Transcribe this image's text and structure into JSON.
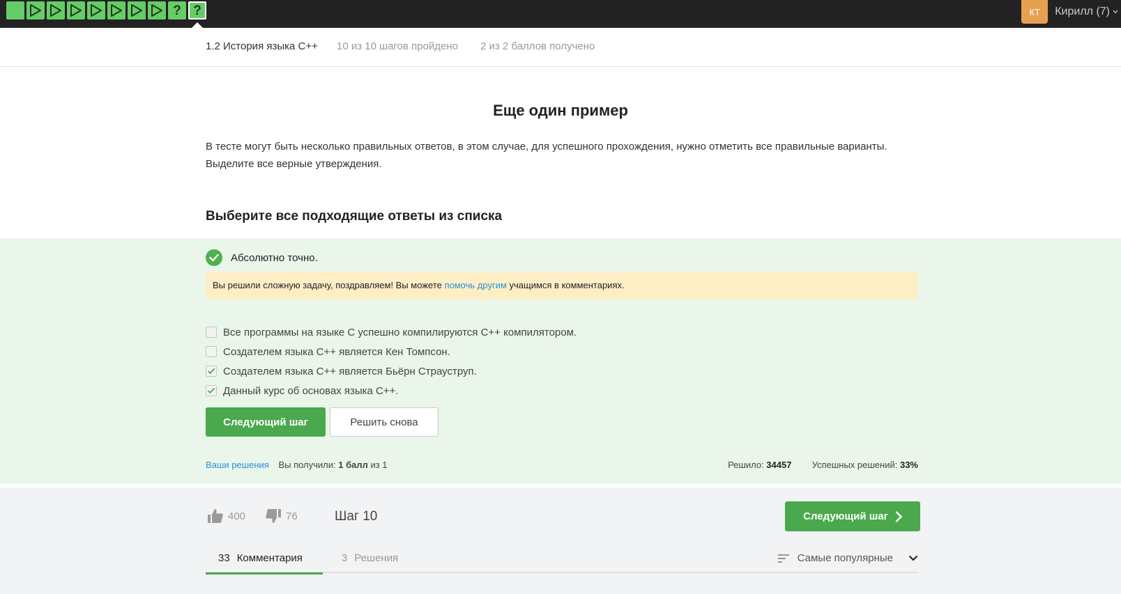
{
  "topbar": {
    "steps": [
      {
        "type": "text",
        "status": "passed"
      },
      {
        "type": "video",
        "status": "passed"
      },
      {
        "type": "video",
        "status": "passed"
      },
      {
        "type": "video",
        "status": "passed"
      },
      {
        "type": "video",
        "status": "passed"
      },
      {
        "type": "video",
        "status": "passed"
      },
      {
        "type": "video",
        "status": "passed"
      },
      {
        "type": "video",
        "status": "passed"
      },
      {
        "type": "quiz",
        "status": "passed",
        "symbol": "?"
      },
      {
        "type": "quiz",
        "status": "current",
        "symbol": "?"
      }
    ],
    "user": {
      "initials": "КТ",
      "name": "Кирилл (7)"
    }
  },
  "lesson": {
    "title": "1.2 История языка C++",
    "progress": "10 из 10 шагов пройдено",
    "points": "2 из 2 баллов  получено"
  },
  "step": {
    "title": "Еще один пример",
    "text": "В тесте могут быть несколько правильных ответов, в этом случае, для успешного прохождения, нужно отметить все правильные варианты. Выделите все верные утверждения.",
    "quiz_title": "Выберите все подходящие ответы из списка"
  },
  "result": {
    "label": "Абсолютно точно.",
    "hint_before": "Вы решили сложную задачу, поздравляем! Вы можете ",
    "hint_link": "помочь другим",
    "hint_after": " учащимся в комментариях."
  },
  "options": [
    {
      "label": "Все программы на языке C успешно компилируются C++ компилятором.",
      "checked": false
    },
    {
      "label": "Создателем языка C++ является Кен Томпсон.",
      "checked": false
    },
    {
      "label": "Создателем языка C++ является Бьёрн Страуструп.",
      "checked": true
    },
    {
      "label": "Данный курс об основах языка C++.",
      "checked": true
    }
  ],
  "buttons": {
    "next": "Следующий шаг",
    "retry": "Решить снова",
    "next_footer": "Следующий шаг"
  },
  "stats": {
    "solutions_link": "Ваши решения",
    "received_label": "Вы получили:",
    "received_value": "1 балл",
    "received_of": "из 1",
    "solved_label": "Решило:",
    "solved_value": "34457",
    "success_label": "Успешных решений:",
    "success_value": "33%"
  },
  "footer": {
    "likes": "400",
    "dislikes": "76",
    "step_label": "Шаг 10"
  },
  "tabs": {
    "comments_count": "33",
    "comments_label": "Комментария",
    "solutions_count": "3",
    "solutions_label": "Решения",
    "sort_label": "Самые популярные"
  },
  "colors": {
    "accent": "#4aa84d",
    "step_passed": "#66cc66",
    "quiz_bg": "#e9f6e9",
    "hint_bg": "#fdeec5",
    "link": "#2c8fd6",
    "avatar": "#e7a04f"
  }
}
